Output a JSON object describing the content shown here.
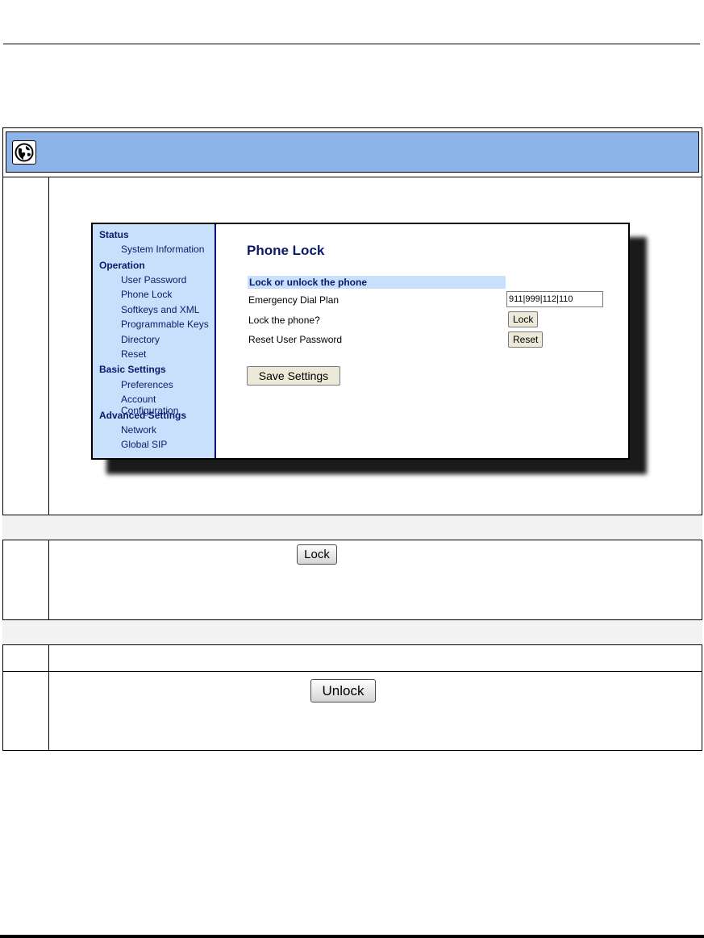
{
  "web_ui": {
    "nav": [
      {
        "type": "head",
        "label": "Status"
      },
      {
        "type": "item",
        "label": "System Information"
      },
      {
        "type": "head",
        "label": "Operation"
      },
      {
        "type": "item",
        "label": "User Password"
      },
      {
        "type": "item",
        "label": "Phone Lock"
      },
      {
        "type": "item",
        "label": "Softkeys and XML"
      },
      {
        "type": "item",
        "label": "Programmable Keys"
      },
      {
        "type": "item",
        "label": "Directory"
      },
      {
        "type": "item",
        "label": "Reset"
      },
      {
        "type": "head",
        "label": "Basic Settings"
      },
      {
        "type": "item",
        "label": "Preferences"
      },
      {
        "type": "item",
        "label": "Account Configuration"
      },
      {
        "type": "head",
        "label": "Advanced Settings"
      },
      {
        "type": "item",
        "label": "Network"
      },
      {
        "type": "item",
        "label": "Global SIP"
      }
    ],
    "page_title": "Phone Lock",
    "section_title": "Lock or unlock the phone",
    "rows": {
      "dial_plan_label": "Emergency Dial Plan",
      "dial_plan_value": "911|999|112|110",
      "lock_label": "Lock the phone?",
      "lock_button": "Lock",
      "reset_label": "Reset User Password",
      "reset_button": "Reset"
    },
    "save_button": "Save Settings"
  },
  "inline_buttons": {
    "lock": "Lock",
    "unlock": "Unlock"
  },
  "colors": {
    "header_band": "#8cb4e8",
    "nav_bg": "#c8e0fb",
    "nav_text": "#0a1a6b"
  }
}
